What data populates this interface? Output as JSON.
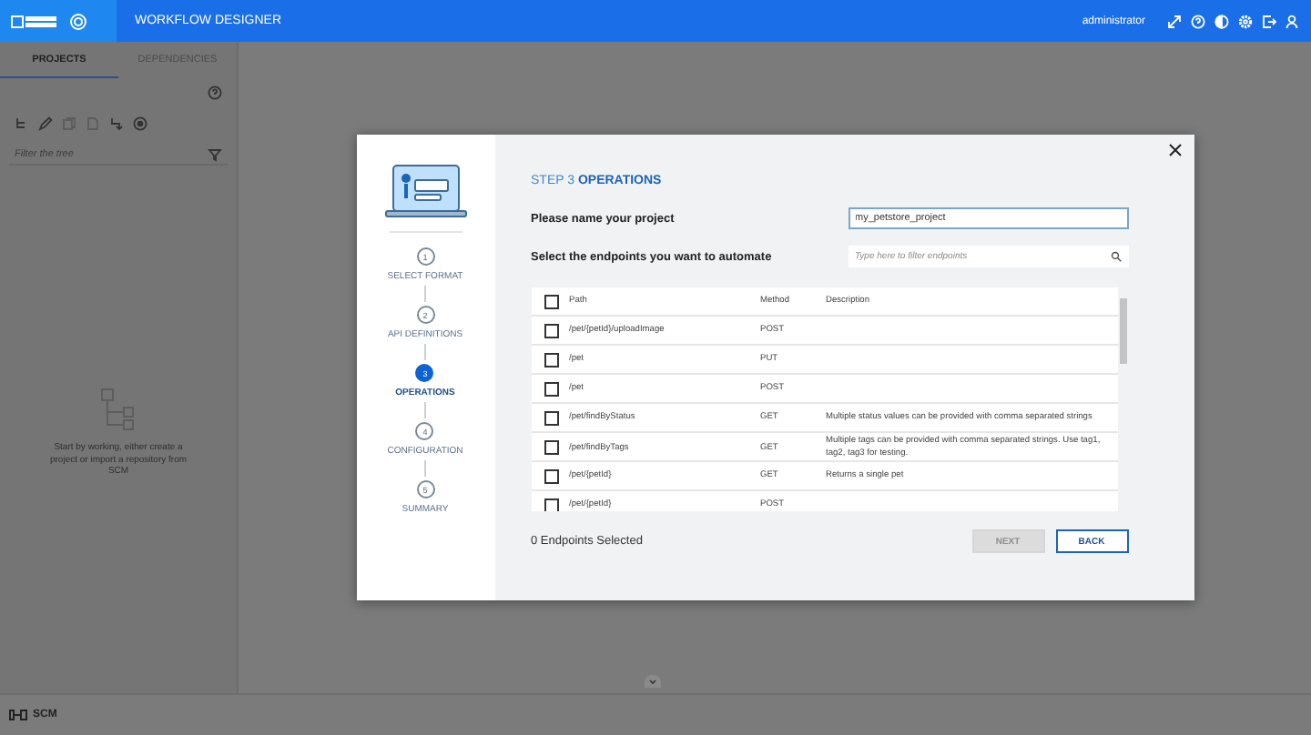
{
  "header": {
    "app_title": "WORKFLOW DESIGNER",
    "user": "administrator"
  },
  "sidebar": {
    "tabs": [
      {
        "label": "PROJECTS",
        "selected": true
      },
      {
        "label": "DEPENDENCIES",
        "selected": false
      }
    ],
    "filter": {
      "placeholder": "Filter the tree"
    },
    "empty_message": "Start by working, either create a project or import a repository from SCM"
  },
  "footer": {
    "label": "SCM"
  },
  "dialog": {
    "steps": [
      {
        "number": "1",
        "label": "SELECT FORMAT",
        "selected": false
      },
      {
        "number": "2",
        "label": "API DEFINITIONS",
        "selected": false
      },
      {
        "number": "3",
        "label": "OPERATIONS",
        "selected": true
      },
      {
        "number": "4",
        "label": "CONFIGURATION",
        "selected": false
      },
      {
        "number": "5",
        "label": "SUMMARY",
        "selected": false
      }
    ],
    "step_prefix": "STEP 3",
    "step_title": "OPERATIONS",
    "name_label": "Please name your project",
    "name_value": "my_petstore_project",
    "endpoints_label": "Select the endpoints you want to automate",
    "filter": {
      "placeholder": "Type here to filter endpoints"
    },
    "table": {
      "all_checked": false,
      "columns": [
        "Path",
        "Method",
        "Description"
      ],
      "rows": [
        {
          "checked": false,
          "path": "/pet/{petId}/uploadImage",
          "method": "POST",
          "description": ""
        },
        {
          "checked": false,
          "path": "/pet",
          "method": "PUT",
          "description": ""
        },
        {
          "checked": false,
          "path": "/pet",
          "method": "POST",
          "description": ""
        },
        {
          "checked": false,
          "path": "/pet/findByStatus",
          "method": "GET",
          "description": "Multiple status values can be provided with comma separated strings"
        },
        {
          "checked": false,
          "path": "/pet/findByTags",
          "method": "GET",
          "description": "Multiple tags can be provided with comma separated strings. Use tag1, tag2, tag3 for testing."
        },
        {
          "checked": false,
          "path": "/pet/{petId}",
          "method": "GET",
          "description": "Returns a single pet"
        },
        {
          "checked": false,
          "path": "/pet/{petId}",
          "method": "POST",
          "description": ""
        }
      ]
    },
    "selected_count": "0 Endpoints Selected",
    "buttons": [
      {
        "label": "NEXT",
        "disabled": true
      },
      {
        "label": "BACK",
        "disabled": false
      }
    ]
  }
}
